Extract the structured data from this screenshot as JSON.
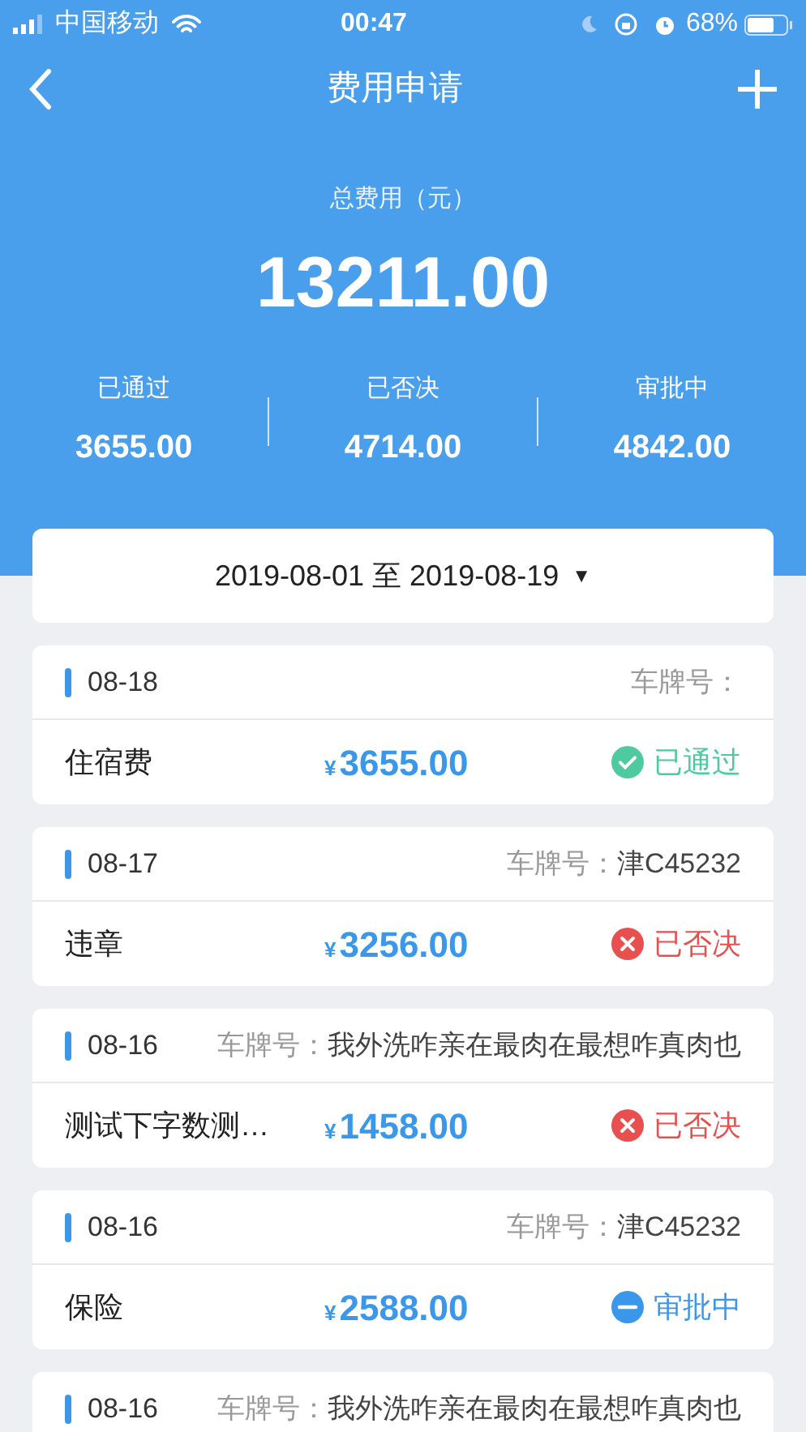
{
  "status_bar": {
    "carrier": "中国移动",
    "time": "00:47",
    "battery": "68%"
  },
  "nav": {
    "title": "费用申请"
  },
  "summary": {
    "label": "总费用（元）",
    "total": "13211.00",
    "stats": [
      {
        "label": "已通过",
        "value": "3655.00"
      },
      {
        "label": "已否决",
        "value": "4714.00"
      },
      {
        "label": "审批中",
        "value": "4842.00"
      }
    ]
  },
  "filter": {
    "date_range": "2019-08-01 至 2019-08-19",
    "caret": "▼"
  },
  "records": [
    {
      "date": "08-18",
      "plate_label": "车牌号：",
      "name": "住宿费",
      "currency": "¥",
      "amount": "3655.00",
      "status": {
        "kind": "approved",
        "label": "已通过"
      }
    },
    {
      "date": "08-17",
      "plate_label": "车牌号：",
      "plate": "津C45232",
      "name": "违章",
      "currency": "¥",
      "amount": "3256.00",
      "status": {
        "kind": "rejected",
        "label": "已否决"
      }
    },
    {
      "date": "08-16",
      "plate_label": "车牌号：",
      "plate": "我外洗咋亲在最肉在最想咋真肉也",
      "name": "测试下字数测…",
      "currency": "¥",
      "amount": "1458.00",
      "status": {
        "kind": "rejected",
        "label": "已否决"
      }
    },
    {
      "date": "08-16",
      "plate_label": "车牌号：",
      "plate": "津C45232",
      "name": "保险",
      "currency": "¥",
      "amount": "2588.00",
      "status": {
        "kind": "pending",
        "label": "审批中"
      }
    },
    {
      "date": "08-16",
      "plate_label": "车牌号：",
      "plate": "我外洗咋亲在最肉在最想咋真肉也"
    }
  ]
}
